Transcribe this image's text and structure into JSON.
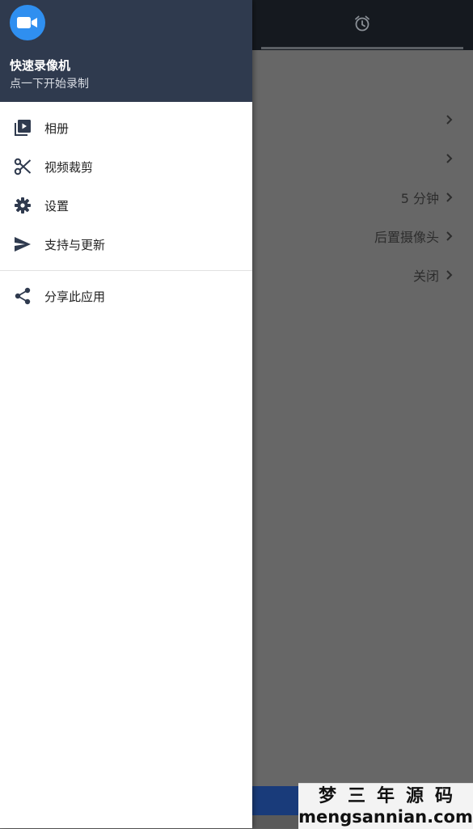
{
  "drawer": {
    "app_name": "快速录像机",
    "app_subtitle": "点一下开始录制",
    "items": [
      {
        "label": "相册",
        "icon": "video-library-icon"
      },
      {
        "label": "视频裁剪",
        "icon": "scissors-icon"
      },
      {
        "label": "设置",
        "icon": "gear-icon"
      },
      {
        "label": "支持与更新",
        "icon": "send-icon"
      },
      {
        "label": "分享此应用",
        "icon": "share-icon"
      }
    ]
  },
  "background": {
    "rows": [
      {
        "value": ""
      },
      {
        "value": ""
      },
      {
        "value": "5 分钟"
      },
      {
        "value": "后置摄像头"
      },
      {
        "value": "关闭"
      }
    ]
  },
  "watermark": {
    "chinese": "梦三年源码",
    "url": "mengsannian.com"
  },
  "colors": {
    "header_bg": "#2f3a4e",
    "logo_blue": "#2f8ff0",
    "topbar_bg": "#15191f",
    "scrim": "#676767"
  }
}
